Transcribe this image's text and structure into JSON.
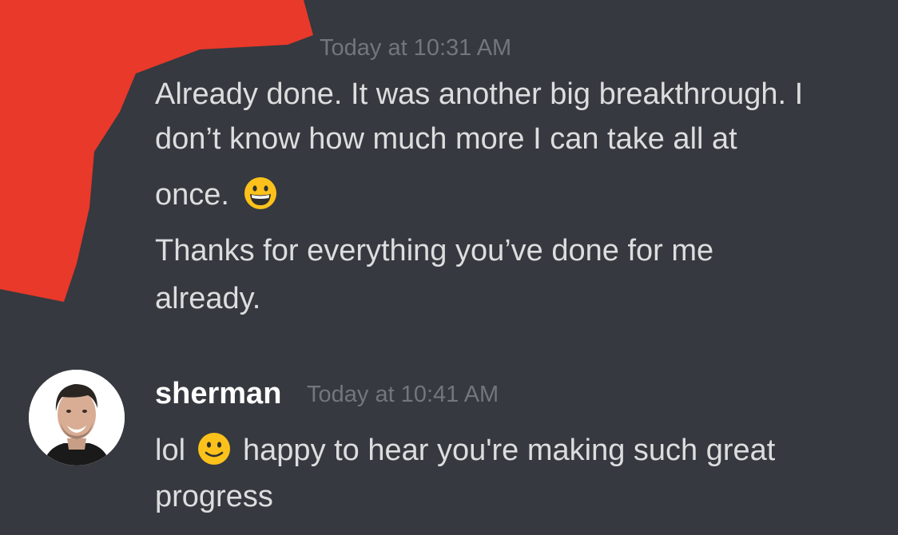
{
  "message_1": {
    "timestamp": "Today at 10:31 AM",
    "lines": [
      "Already done. It was another big breakthrough. I",
      "don’t know how much more I can take all at",
      "once.",
      "Thanks for everything you’ve done for me",
      "already."
    ],
    "emoji": "grinning-face-icon"
  },
  "message_2": {
    "username": "sherman",
    "timestamp": "Today at 10:41 AM",
    "line_1_before_emoji": "lol",
    "line_1_after_emoji": "happy to hear you're making such great",
    "line_2": "progress",
    "emoji": "slightly-smiling-face-icon"
  },
  "colors": {
    "background": "#36393f",
    "text": "#dcddde",
    "timestamp": "#72767d",
    "username": "#ffffff",
    "redaction": "#e8392a"
  }
}
